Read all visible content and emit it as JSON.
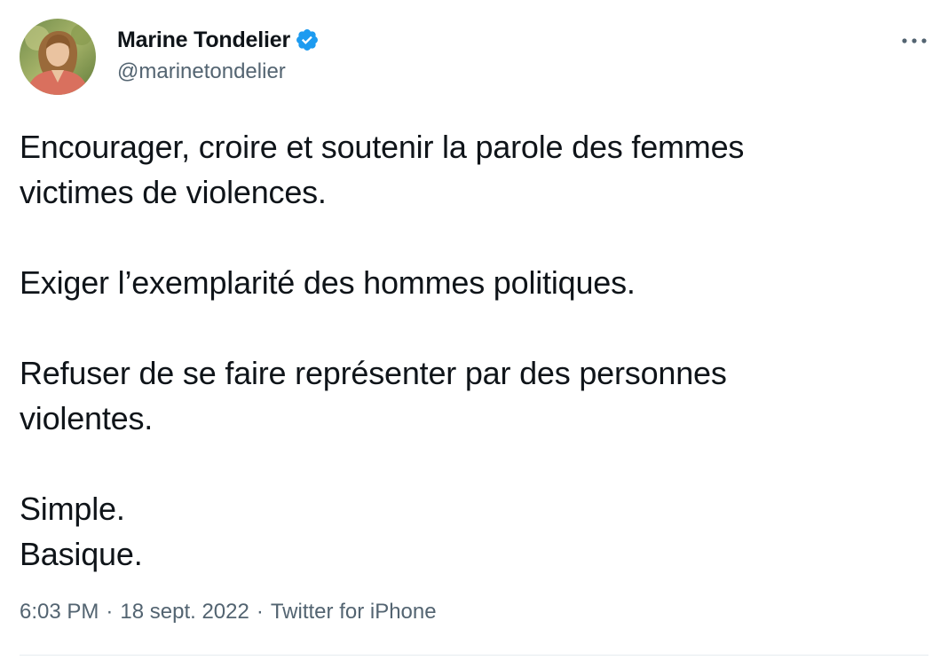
{
  "tweet": {
    "author": {
      "display_name": "Marine Tondelier",
      "handle": "@marinetondelier",
      "verified": true,
      "avatar_icon": "profile-photo"
    },
    "more_icon": "more-dots-icon",
    "text": "Encourager, croire et soutenir la parole des femmes\nvictimes de violences.\n\nExiger l’exemplarité des hommes politiques.\n\nRefuser de se faire représenter par des personnes\nviolentes.\n\nSimple.\nBasique.",
    "meta": {
      "time": "6:03 PM",
      "separator": "·",
      "date": "18 sept. 2022",
      "source": "Twitter for iPhone"
    }
  },
  "colors": {
    "text_primary": "#0f1419",
    "text_secondary": "#536471",
    "verified_blue": "#1d9bf0",
    "divider": "#e6ecf0"
  }
}
